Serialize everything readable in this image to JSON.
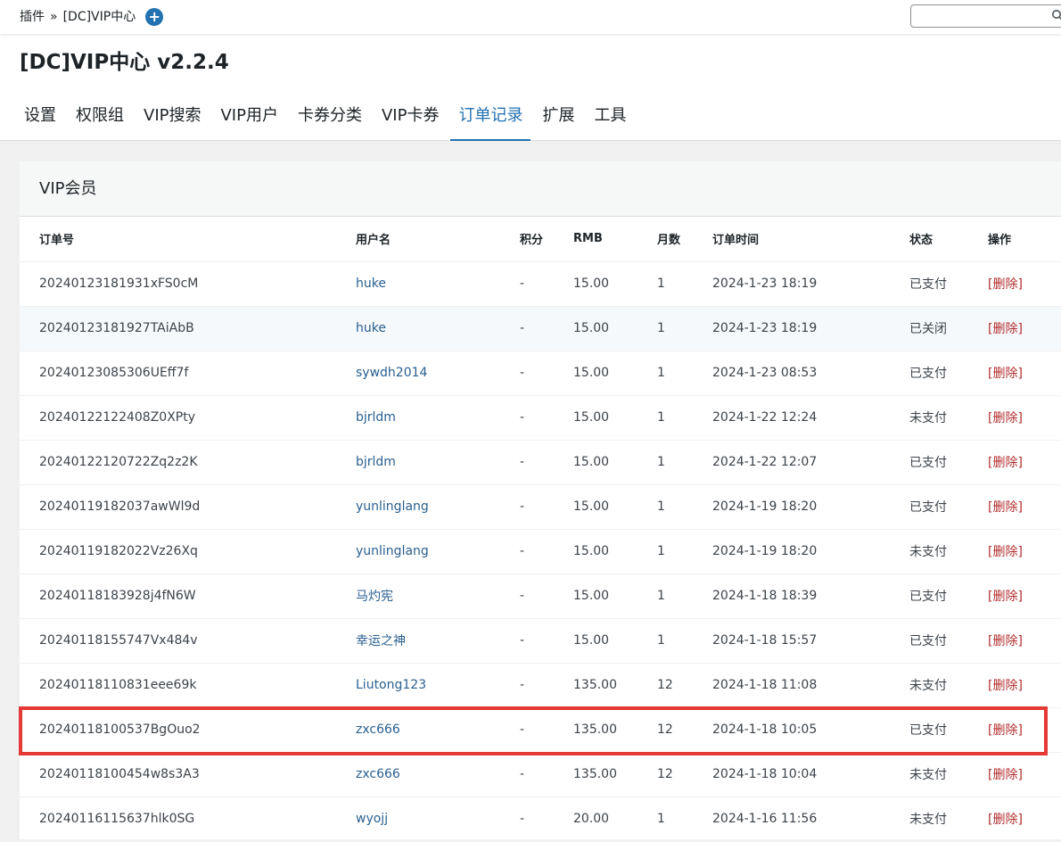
{
  "breadcrumb": {
    "parent": "插件",
    "separator": "»",
    "current": "[DC]VIP中心",
    "add_icon": "+"
  },
  "search": {
    "value": "",
    "placeholder": ""
  },
  "page_title": "[DC]VIP中心 v2.2.4",
  "tabs": [
    {
      "label": "设置",
      "active": false
    },
    {
      "label": "权限组",
      "active": false
    },
    {
      "label": "VIP搜索",
      "active": false
    },
    {
      "label": "VIP用户",
      "active": false
    },
    {
      "label": "卡券分类",
      "active": false
    },
    {
      "label": "VIP卡券",
      "active": false
    },
    {
      "label": "订单记录",
      "active": true
    },
    {
      "label": "扩展",
      "active": false
    },
    {
      "label": "工具",
      "active": false
    }
  ],
  "panel": {
    "title": "VIP会员",
    "columns": [
      "订单号",
      "用户名",
      "积分",
      "RMB",
      "月数",
      "订单时间",
      "状态",
      "操作"
    ],
    "rows": [
      {
        "order_no": "20240123181931xFS0cM",
        "user": "huke",
        "points": "-",
        "rmb": "15.00",
        "months": "1",
        "time": "2024-1-23 18:19",
        "status": "已支付",
        "action": "[删除]"
      },
      {
        "order_no": "20240123181927TAiAbB",
        "user": "huke",
        "points": "-",
        "rmb": "15.00",
        "months": "1",
        "time": "2024-1-23 18:19",
        "status": "已关闭",
        "action": "[删除]"
      },
      {
        "order_no": "20240123085306UEff7f",
        "user": "sywdh2014",
        "points": "-",
        "rmb": "15.00",
        "months": "1",
        "time": "2024-1-23 08:53",
        "status": "已支付",
        "action": "[删除]"
      },
      {
        "order_no": "20240122122408Z0XPty",
        "user": "bjrldm",
        "points": "-",
        "rmb": "15.00",
        "months": "1",
        "time": "2024-1-22 12:24",
        "status": "未支付",
        "action": "[删除]"
      },
      {
        "order_no": "20240122120722Zq2z2K",
        "user": "bjrldm",
        "points": "-",
        "rmb": "15.00",
        "months": "1",
        "time": "2024-1-22 12:07",
        "status": "已支付",
        "action": "[删除]"
      },
      {
        "order_no": "20240119182037awWl9d",
        "user": "yunlinglang",
        "points": "-",
        "rmb": "15.00",
        "months": "1",
        "time": "2024-1-19 18:20",
        "status": "已支付",
        "action": "[删除]"
      },
      {
        "order_no": "20240119182022Vz26Xq",
        "user": "yunlinglang",
        "points": "-",
        "rmb": "15.00",
        "months": "1",
        "time": "2024-1-19 18:20",
        "status": "未支付",
        "action": "[删除]"
      },
      {
        "order_no": "20240118183928j4fN6W",
        "user": "马灼宪",
        "points": "-",
        "rmb": "15.00",
        "months": "1",
        "time": "2024-1-18 18:39",
        "status": "已支付",
        "action": "[删除]"
      },
      {
        "order_no": "20240118155747Vx484v",
        "user": "幸运之神",
        "points": "-",
        "rmb": "15.00",
        "months": "1",
        "time": "2024-1-18 15:57",
        "status": "已支付",
        "action": "[删除]"
      },
      {
        "order_no": "20240118110831eee69k",
        "user": "Liutong123",
        "points": "-",
        "rmb": "135.00",
        "months": "12",
        "time": "2024-1-18 11:08",
        "status": "未支付",
        "action": "[删除]"
      },
      {
        "order_no": "20240118100537BgOuo2",
        "user": "zxc666",
        "points": "-",
        "rmb": "135.00",
        "months": "12",
        "time": "2024-1-18 10:05",
        "status": "已支付",
        "action": "[删除]"
      },
      {
        "order_no": "20240118100454w8s3A3",
        "user": "zxc666",
        "points": "-",
        "rmb": "135.00",
        "months": "12",
        "time": "2024-1-18 10:04",
        "status": "未支付",
        "action": "[删除]"
      },
      {
        "order_no": "20240116115637hlk0SG",
        "user": "wyojj",
        "points": "-",
        "rmb": "20.00",
        "months": "1",
        "time": "2024-1-16 11:56",
        "status": "未支付",
        "action": "[删除]"
      }
    ]
  },
  "colors": {
    "accent": "#2271b1",
    "link": "#2a5f8f",
    "delete": "#b32d2e",
    "highlight": "#e53935"
  }
}
